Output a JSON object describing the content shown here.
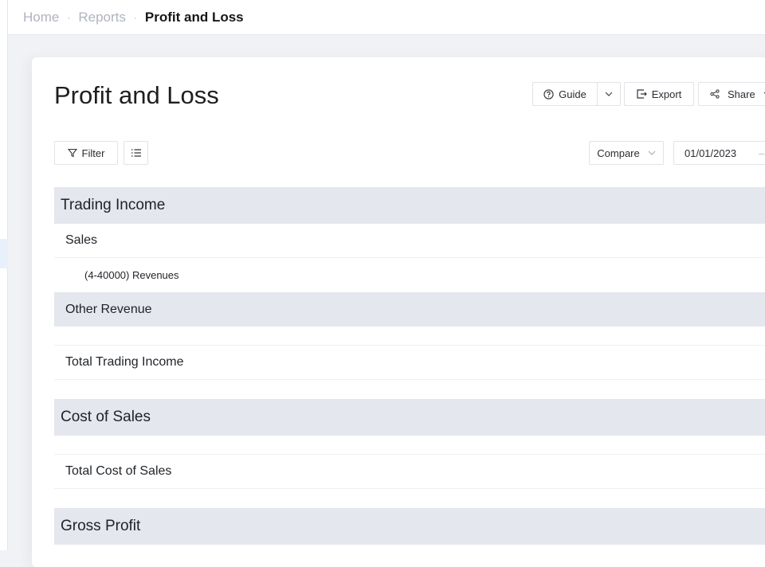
{
  "breadcrumb": {
    "items": [
      "Home",
      "Reports"
    ],
    "current": "Profit and Loss"
  },
  "page": {
    "title": "Profit and Loss"
  },
  "toolbar": {
    "guide": "Guide",
    "export": "Export",
    "share": "Share",
    "filter": "Filter",
    "compare": "Compare",
    "date_from": "01/01/2023"
  },
  "report": {
    "trading_income": "Trading Income",
    "sales": "Sales",
    "revenues": "(4-40000) Revenues",
    "other_revenue": "Other Revenue",
    "total_trading_income": "Total Trading Income",
    "cost_of_sales": "Cost of Sales",
    "total_cost_of_sales": "Total Cost of Sales",
    "gross_profit": "Gross Profit"
  },
  "colors": {
    "section_bg": "#e4e7ee",
    "page_bg": "#f1f2f5"
  }
}
